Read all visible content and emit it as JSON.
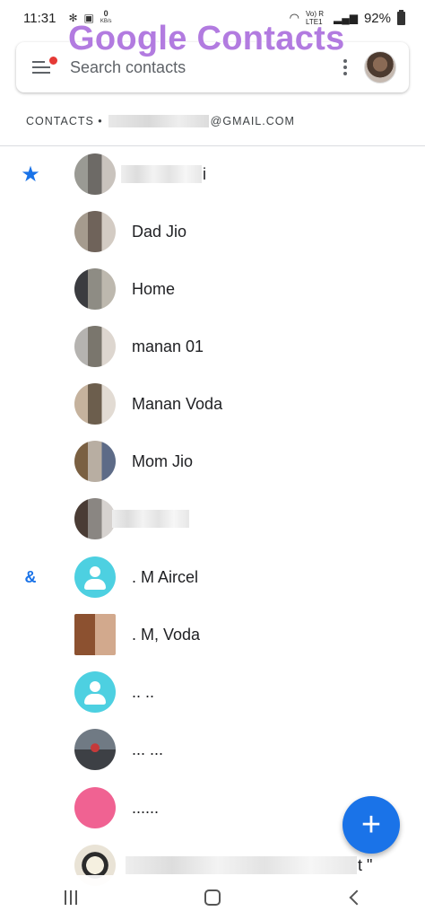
{
  "status_bar": {
    "time": "11:31",
    "data_speed": "0",
    "data_unit": "KB/s",
    "battery": "92%",
    "network": "Vo) R LTE1"
  },
  "watermark": "Google Contacts",
  "search": {
    "placeholder": "Search contacts"
  },
  "account": {
    "prefix": "CONTACTS •",
    "email_suffix": "@GMAIL.COM"
  },
  "contacts": [
    {
      "section": "★",
      "name": "i",
      "avatar": "blurred-photo"
    },
    {
      "section": "",
      "name": "Dad Jio",
      "avatar": "blurred-photo"
    },
    {
      "section": "",
      "name": "Home",
      "avatar": "blurred-photo"
    },
    {
      "section": "",
      "name": "manan 01",
      "avatar": "blurred-photo"
    },
    {
      "section": "",
      "name": "Manan Voda",
      "avatar": "blurred-photo"
    },
    {
      "section": "",
      "name": "Mom Jio",
      "avatar": "blurred-photo"
    },
    {
      "section": "",
      "name": "",
      "avatar": "blurred-photo"
    },
    {
      "section": "&",
      "name": ". M Aircel",
      "avatar": "default-person"
    },
    {
      "section": "",
      "name": ". M, Voda",
      "avatar": "photo"
    },
    {
      "section": "",
      "name": ".. ..",
      "avatar": "default-person"
    },
    {
      "section": "",
      "name": "... ...",
      "avatar": "photo"
    },
    {
      "section": "",
      "name": "......",
      "avatar": "pink-circle"
    },
    {
      "section": "",
      "name": "t \"",
      "avatar": "cartoon"
    }
  ],
  "fab": {
    "label": "+"
  },
  "colors": {
    "accent": "#1a73e8",
    "watermark": "#b27be0",
    "default_avatar": "#4dd0e1",
    "pink_avatar": "#f06292",
    "notification_dot": "#e53935"
  },
  "icons": [
    "star-icon",
    "menu-icon",
    "more-vert-icon",
    "add-icon",
    "recents-icon",
    "home-icon",
    "back-icon"
  ]
}
